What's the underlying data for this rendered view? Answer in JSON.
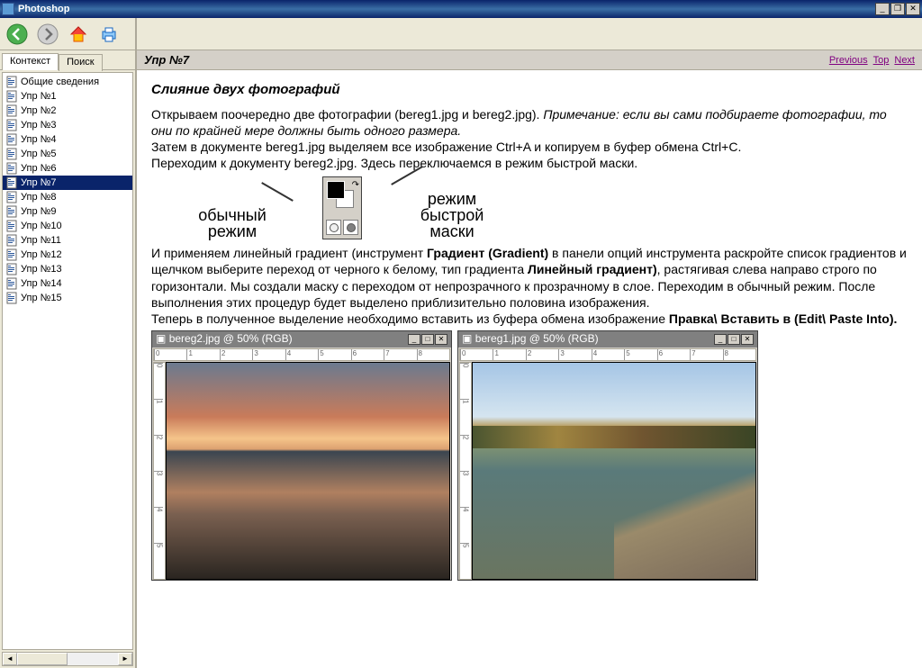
{
  "window": {
    "title": "Photoshop"
  },
  "tabs": {
    "context": "Контекст",
    "search": "Поиск"
  },
  "tree": {
    "items": [
      "Общие сведения",
      "Упр №1",
      "Упр №2",
      "Упр №3",
      "Упр №4",
      "Упр №5",
      "Упр №6",
      "Упр №7",
      "Упр №8",
      "Упр №9",
      "Упр №10",
      "Упр №11",
      "Упр №12",
      "Упр №13",
      "Упр №14",
      "Упр №15"
    ],
    "selected_index": 7
  },
  "nav": {
    "previous": "Previous",
    "top": "Top",
    "next": "Next"
  },
  "page": {
    "title": "Упр №7",
    "heading": "Слияние двух фотографий",
    "p1a": "Открываем поочередно две фотографии (bereg1.jpg и bereg2.jpg). ",
    "p1b": "Примечание: если вы сами подбираете фотографии, то они по крайней мере должны быть одного размера.",
    "p2": "Затем в документе bereg1.jpg выделяем все изображение Ctrl+A и копируем в буфер обмена Ctrl+C.",
    "p3": "Переходим к документу bereg2.jpg. Здесь переключаемся в режим быстрой маски.",
    "mode_normal_1": "обычный",
    "mode_normal_2": "режим",
    "mode_quick_1": "режим",
    "mode_quick_2": "быстрой",
    "mode_quick_3": "маски",
    "p4a": "И применяем линейный градиент (инструмент ",
    "p4b": "Градиент (Gradient)",
    "p4c": " в панели опций инструмента раскройте список градиентов и щелчком выберите переход от черного к белому, тип градиента ",
    "p4d": "Линейный градиент)",
    "p4e": ", растягивая слева направо строго по горизонтали. Мы создали маску с переходом от непрозрачного к прозрачному в слое. Переходим в обычный режим. После выполнения этих процедур будет выделено приблизительно половина изображения.",
    "p5a": "Теперь в полученное выделение необходимо вставить из буфера обмена изображение ",
    "p5b": "Правка\\ Вставить в (Edit\\ Paste Into).",
    "photo1_title": "bereg2.jpg @ 50% (RGB)",
    "photo2_title": "bereg1.jpg @ 50% (RGB)"
  }
}
